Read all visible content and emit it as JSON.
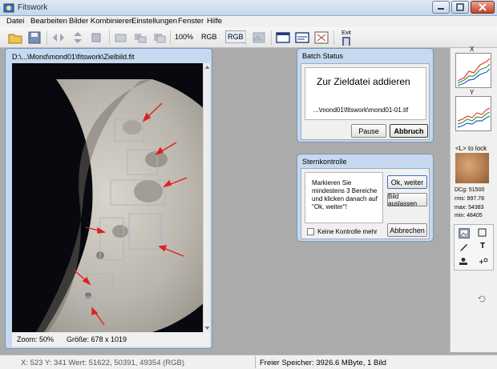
{
  "app": {
    "title": "Fitswork"
  },
  "menu": [
    "Datei",
    "Bearbeiten",
    "Bilder Kombinieren",
    "Einstellungen",
    "Fenster",
    "Hilfe"
  ],
  "toolbar": {
    "zoom_label": "100%",
    "rgb1_label": "RGB",
    "rgb2_label": "RGB",
    "exit_label": "Exit"
  },
  "image_window": {
    "title": "D:\\...\\Mond\\mond01\\fitswork\\Zielbild.fit",
    "zoom": "Zoom: 50%",
    "size": "Größe: 678 x 1019"
  },
  "batch_status": {
    "title": "Batch Status",
    "heading": "Zur Zieldatei addieren",
    "path": "...\\mond01\\fitswork\\mond01-01.tif",
    "pause_label": "Pause",
    "abort_label": "Abbruch"
  },
  "sternkontrolle": {
    "title": "Sternkontrolle",
    "instructions": "Markieren Sie mindestens 3 Bereiche und klicken danach auf \"Ok, weiter\"!",
    "ok_label": "Ok, weiter",
    "skip_label": "Bild auslassen",
    "cancel_label": "Abbrechen",
    "checkbox_label": "Keine Kontrolle mehr",
    "checkbox_checked": false
  },
  "right_panel": {
    "x_label": "X",
    "y_label": "Y",
    "lock_hint": "<L> to lock",
    "stats": [
      "DCg: 51500",
      "rms: 997.78",
      "max: 54383",
      "min: 48405"
    ]
  },
  "statusbar": {
    "coords": "X: 523  Y: 341  Wert: 51622, 50391, 49354 (RGB)",
    "memory": "Freier Speicher: 3926.6 MByte, 1 Bild"
  },
  "colors": {
    "window_frame": "#c7d9ee",
    "arrow_red": "#e0201c",
    "selection_box": "#aab4c8",
    "graph_red": "#e53935",
    "graph_green": "#2e9e3e",
    "graph_blue": "#2b56c9"
  }
}
